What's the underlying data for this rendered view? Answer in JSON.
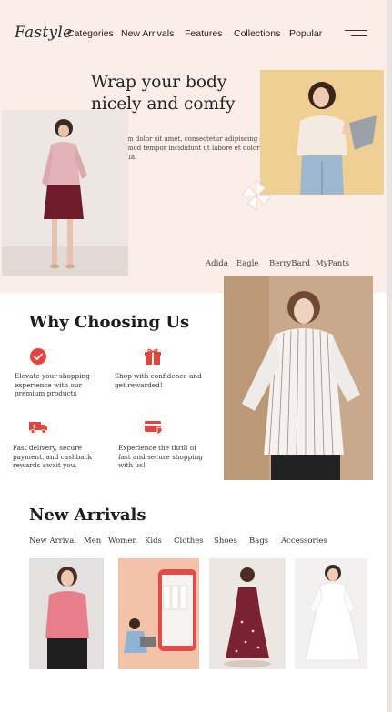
{
  "brand": {
    "logo": "Fastyle"
  },
  "nav": {
    "items": [
      "Categories",
      "New Arrivals",
      "Features",
      "Collections",
      "Popular"
    ],
    "menu_icon": "hamburger-icon"
  },
  "hero": {
    "heading": "Wrap your body nicely and comfy",
    "description": "Lorem ipsum dolor sit amet, consectetur adipiscing elit, sed do eiusmod tempor incididunt ut labore et dolore magna aliqua.",
    "brands": [
      "Adida",
      "Eagle",
      "BerryBard",
      "MyPants"
    ]
  },
  "why": {
    "title": "Why Choosing Us",
    "features": [
      {
        "icon": "check-badge-icon",
        "text": "Elevate your shopping experience with our premium products"
      },
      {
        "icon": "gift-icon",
        "text": "Shop with confidence and get rewarded!"
      },
      {
        "icon": "delivery-truck-icon",
        "text": "Fast delivery, secure payment, and cashback rewards await you."
      },
      {
        "icon": "secure-card-icon",
        "text": "Experience the thrill of fast and secure shopping with us!"
      }
    ]
  },
  "arrivals": {
    "title": "New Arrivals",
    "categories": [
      "New Arrival",
      "Men",
      "Women",
      "Kids",
      "Clothes",
      "Shoes",
      "Bags",
      "Accessories"
    ]
  },
  "colors": {
    "accent": "#e0463f",
    "hero_bg": "#fbeee9",
    "text": "#1d1d1d"
  }
}
